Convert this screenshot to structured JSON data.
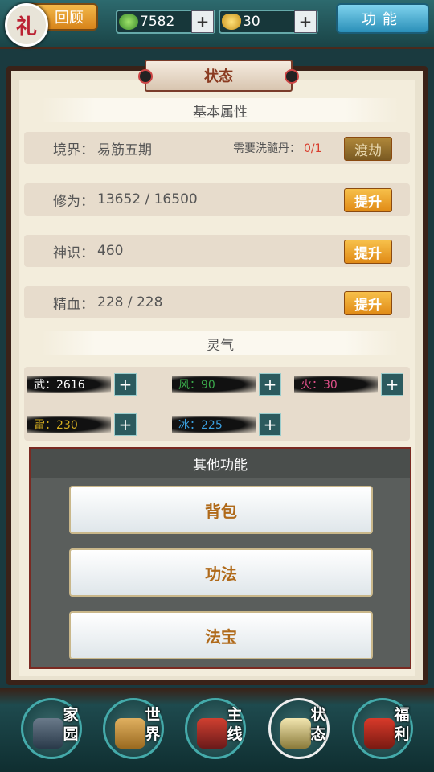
{
  "topbar": {
    "gift_icon_char": "礼",
    "review_label": "回顾",
    "jade_value": "7582",
    "gold_value": "30",
    "plus": "+",
    "function_label": "功能"
  },
  "panel": {
    "title": "状态",
    "basic_section": "基本属性",
    "rows": [
      {
        "label": "境界：",
        "value": "易筋五期",
        "need_label": "需要洗髓丹：",
        "need_count": "0/1",
        "button": "渡劫"
      },
      {
        "label": "修为：",
        "value": "13652 / 16500",
        "button": "提升"
      },
      {
        "label": "神识：",
        "value": "460",
        "button": "提升"
      },
      {
        "label": "精血：",
        "value": "228 / 228",
        "button": "提升"
      }
    ],
    "qi_section": "灵气",
    "qi": [
      {
        "label": "武：2616",
        "color": "#ffffff"
      },
      {
        "label": "风：90",
        "color": "#3aa84a"
      },
      {
        "label": "火：30",
        "color": "#e0508a"
      },
      {
        "label": "雷：230",
        "color": "#d8b020"
      },
      {
        "label": "冰：225",
        "color": "#3aa0e0"
      }
    ]
  },
  "other": {
    "title": "其他功能",
    "buttons": [
      "背包",
      "功法",
      "法宝"
    ]
  },
  "nav": [
    {
      "label": "家园",
      "icon": "home-icon"
    },
    {
      "label": "世界",
      "icon": "world-icon"
    },
    {
      "label": "主线",
      "icon": "quest-icon"
    },
    {
      "label": "状态",
      "icon": "status-icon"
    },
    {
      "label": "福利",
      "icon": "welfare-icon"
    }
  ],
  "colors": {
    "accent_orange": "#e08a16",
    "accent_teal": "#1e4a4e",
    "warning_red": "#d83a2a"
  }
}
